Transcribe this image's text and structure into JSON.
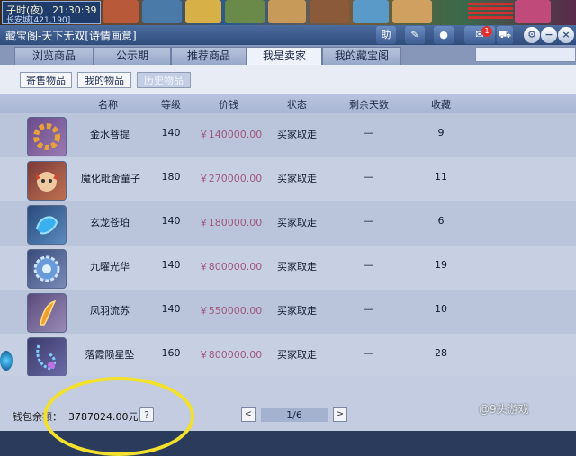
{
  "game_hud": {
    "time_label": "子时(夜)",
    "clock": "21:30:39",
    "location": "长安城[421,190]"
  },
  "window": {
    "title": "藏宝阁-天下无双[诗情画意]",
    "toolbar_help_label": "助",
    "message_badge": "1"
  },
  "tabs": [
    {
      "label": "浏览商品"
    },
    {
      "label": "公示期"
    },
    {
      "label": "推荐商品"
    },
    {
      "label": "我是卖家"
    },
    {
      "label": "我的藏宝阁"
    }
  ],
  "active_tab": "我是卖家",
  "subtabs": [
    {
      "label": "寄售物品"
    },
    {
      "label": "我的物品"
    },
    {
      "label": "历史物品"
    }
  ],
  "active_subtab": "历史物品",
  "table": {
    "headers": [
      "名称",
      "等级",
      "价钱",
      "状态",
      "剩余天数",
      "收藏"
    ],
    "rows": [
      {
        "name": "金水菩提",
        "level": "140",
        "price": "￥140000.00",
        "status": "买家取走",
        "days": "—",
        "fav": "9",
        "icon": "golden-bead-necklace-icon"
      },
      {
        "name": "魔化毗舍童子",
        "level": "180",
        "price": "￥270000.00",
        "status": "买家取走",
        "days": "—",
        "fav": "11",
        "icon": "demon-child-icon"
      },
      {
        "name": "玄龙苍珀",
        "level": "140",
        "price": "￥180000.00",
        "status": "买家取走",
        "days": "—",
        "fav": "6",
        "icon": "blue-dragon-amber-icon"
      },
      {
        "name": "九曜光华",
        "level": "140",
        "price": "￥800000.00",
        "status": "买家取走",
        "days": "—",
        "fav": "19",
        "icon": "blue-gem-cluster-icon"
      },
      {
        "name": "凤羽流苏",
        "level": "140",
        "price": "￥550000.00",
        "status": "买家取走",
        "days": "—",
        "fav": "10",
        "icon": "phoenix-feather-icon"
      },
      {
        "name": "落霞陨星坠",
        "level": "160",
        "price": "￥800000.00",
        "status": "买家取走",
        "days": "—",
        "fav": "28",
        "icon": "star-pendant-icon"
      }
    ]
  },
  "footer": {
    "wallet_label": "钱包余额：",
    "wallet_value": "3787024.00元",
    "help": "?",
    "prev": "<",
    "page": "1/6",
    "next": ">"
  },
  "watermark": "@9头游戏",
  "colors": {
    "price_text": "#a0587e",
    "highlight_oval": "#f2e02c",
    "title_bar": "#2f4c7c"
  }
}
